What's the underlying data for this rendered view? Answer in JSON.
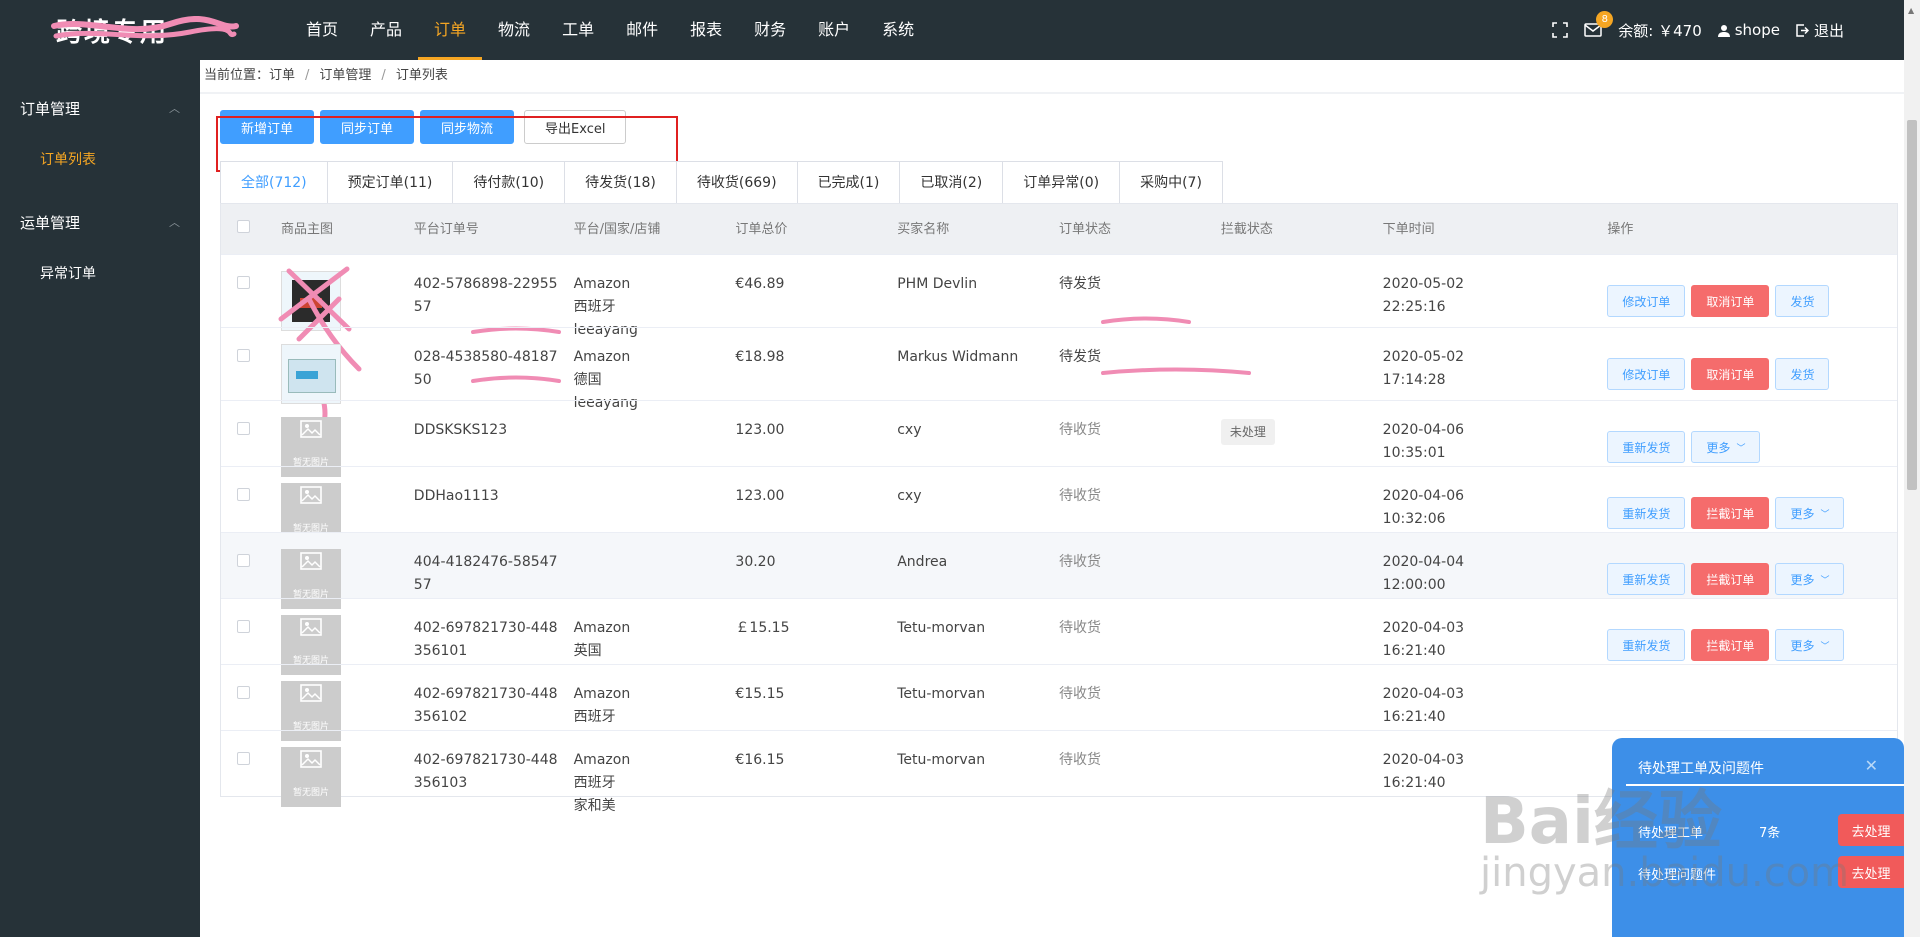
{
  "brand": {
    "logo": "跨境专用"
  },
  "nav": {
    "items": [
      "首页",
      "产品",
      "订单",
      "物流",
      "工单",
      "邮件",
      "报表",
      "财务",
      "账户",
      "系统"
    ],
    "active_index": 2
  },
  "header_right": {
    "mail_badge": "8",
    "balance": "余额: ￥470",
    "user": "shope",
    "logout": "退出"
  },
  "sidebar": {
    "group1": "订单管理",
    "group1_items": [
      "订单列表"
    ],
    "group2": "运单管理",
    "group2_items": [
      "异常订单"
    ]
  },
  "breadcrumb": {
    "prefix": "当前位置：订单",
    "level2": "订单管理",
    "level3": "订单列表",
    "sep": "/"
  },
  "toolbar": {
    "add": "新增订单",
    "sync_orders": "同步订单",
    "sync_logistics": "同步物流",
    "export": "导出Excel"
  },
  "tabs": [
    "全部(712)",
    "预定订单(11)",
    "待付款(10)",
    "待发货(18)",
    "待收货(669)",
    "已完成(1)",
    "已取消(2)",
    "订单异常(0)",
    "采购中(7)"
  ],
  "table": {
    "headers": [
      "商品主图",
      "平台订单号",
      "平台/国家/店铺",
      "订单总价",
      "买家名称",
      "订单状态",
      "拦截状态",
      "下单时间",
      "操作"
    ],
    "no_image": "暂无图片",
    "rows": [
      {
        "order_no": [
          "402-5786898-22955",
          "57"
        ],
        "platform": [
          "Amazon",
          "西班牙",
          "leeayang"
        ],
        "total": "€46.89",
        "buyer": "PHM Devlin",
        "status": "待发货",
        "intercept": "",
        "date": "2020-05-02",
        "time": "22:25:16",
        "ops": [
          "修改订单",
          "取消订单",
          "发货"
        ]
      },
      {
        "order_no": [
          "028-4538580-48187",
          "50"
        ],
        "platform": [
          "Amazon",
          "德国",
          "leeayang"
        ],
        "total": "€18.98",
        "buyer": "Markus Widmann",
        "status": "待发货",
        "intercept": "",
        "date": "2020-05-02",
        "time": "17:14:28",
        "ops": [
          "修改订单",
          "取消订单",
          "发货"
        ]
      },
      {
        "order_no": [
          "DDSKSKS123"
        ],
        "platform": [],
        "total": "123.00",
        "buyer": "cxy",
        "status": "待收货",
        "intercept": "未处理",
        "date": "2020-04-06",
        "time": "10:35:01",
        "ops": [
          "重新发货",
          "更多"
        ]
      },
      {
        "order_no": [
          "DDHao1113"
        ],
        "platform": [],
        "total": "123.00",
        "buyer": "cxy",
        "status": "待收货",
        "intercept": "",
        "date": "2020-04-06",
        "time": "10:32:06",
        "ops": [
          "重新发货",
          "拦截订单",
          "更多"
        ]
      },
      {
        "order_no": [
          "404-4182476-58547",
          "57"
        ],
        "platform": [],
        "total": "30.20",
        "buyer": "Andrea",
        "status": "待收货",
        "intercept": "",
        "date": "2020-04-04",
        "time": "12:00:00",
        "ops": [
          "重新发货",
          "拦截订单",
          "更多"
        ]
      },
      {
        "order_no": [
          "402-697821730-448",
          "356101"
        ],
        "platform": [
          "Amazon",
          "英国"
        ],
        "total": "￡15.15",
        "buyer": "Tetu-morvan",
        "status": "待收货",
        "intercept": "",
        "date": "2020-04-03",
        "time": "16:21:40",
        "ops": [
          "重新发货",
          "拦截订单",
          "更多"
        ]
      },
      {
        "order_no": [
          "402-697821730-448",
          "356102"
        ],
        "platform": [
          "Amazon",
          "西班牙"
        ],
        "total": "€15.15",
        "buyer": "Tetu-morvan",
        "status": "待收货",
        "intercept": "",
        "date": "2020-04-03",
        "time": "16:21:40",
        "ops": []
      },
      {
        "order_no": [
          "402-697821730-448",
          "356103"
        ],
        "platform": [
          "Amazon",
          "西班牙",
          "家和美"
        ],
        "total": "€16.15",
        "buyer": "Tetu-morvan",
        "status": "待收货",
        "intercept": "",
        "date": "2020-04-03",
        "time": "16:21:40",
        "ops": []
      }
    ]
  },
  "popup": {
    "title": "待处理工单及问题件",
    "row1": "待处理工单",
    "row1_count": "7条",
    "row2": "待处理问题件",
    "button": "去处理"
  },
  "watermark": {
    "line1": "Bai经验",
    "line2": "jingyan.baidu.com"
  },
  "colors": {
    "nav_bg": "#263238",
    "accent": "#f5a623",
    "primary": "#409eff",
    "danger": "#f56c6c",
    "annotation": "#e02020",
    "scribble": "#f08cb4"
  }
}
